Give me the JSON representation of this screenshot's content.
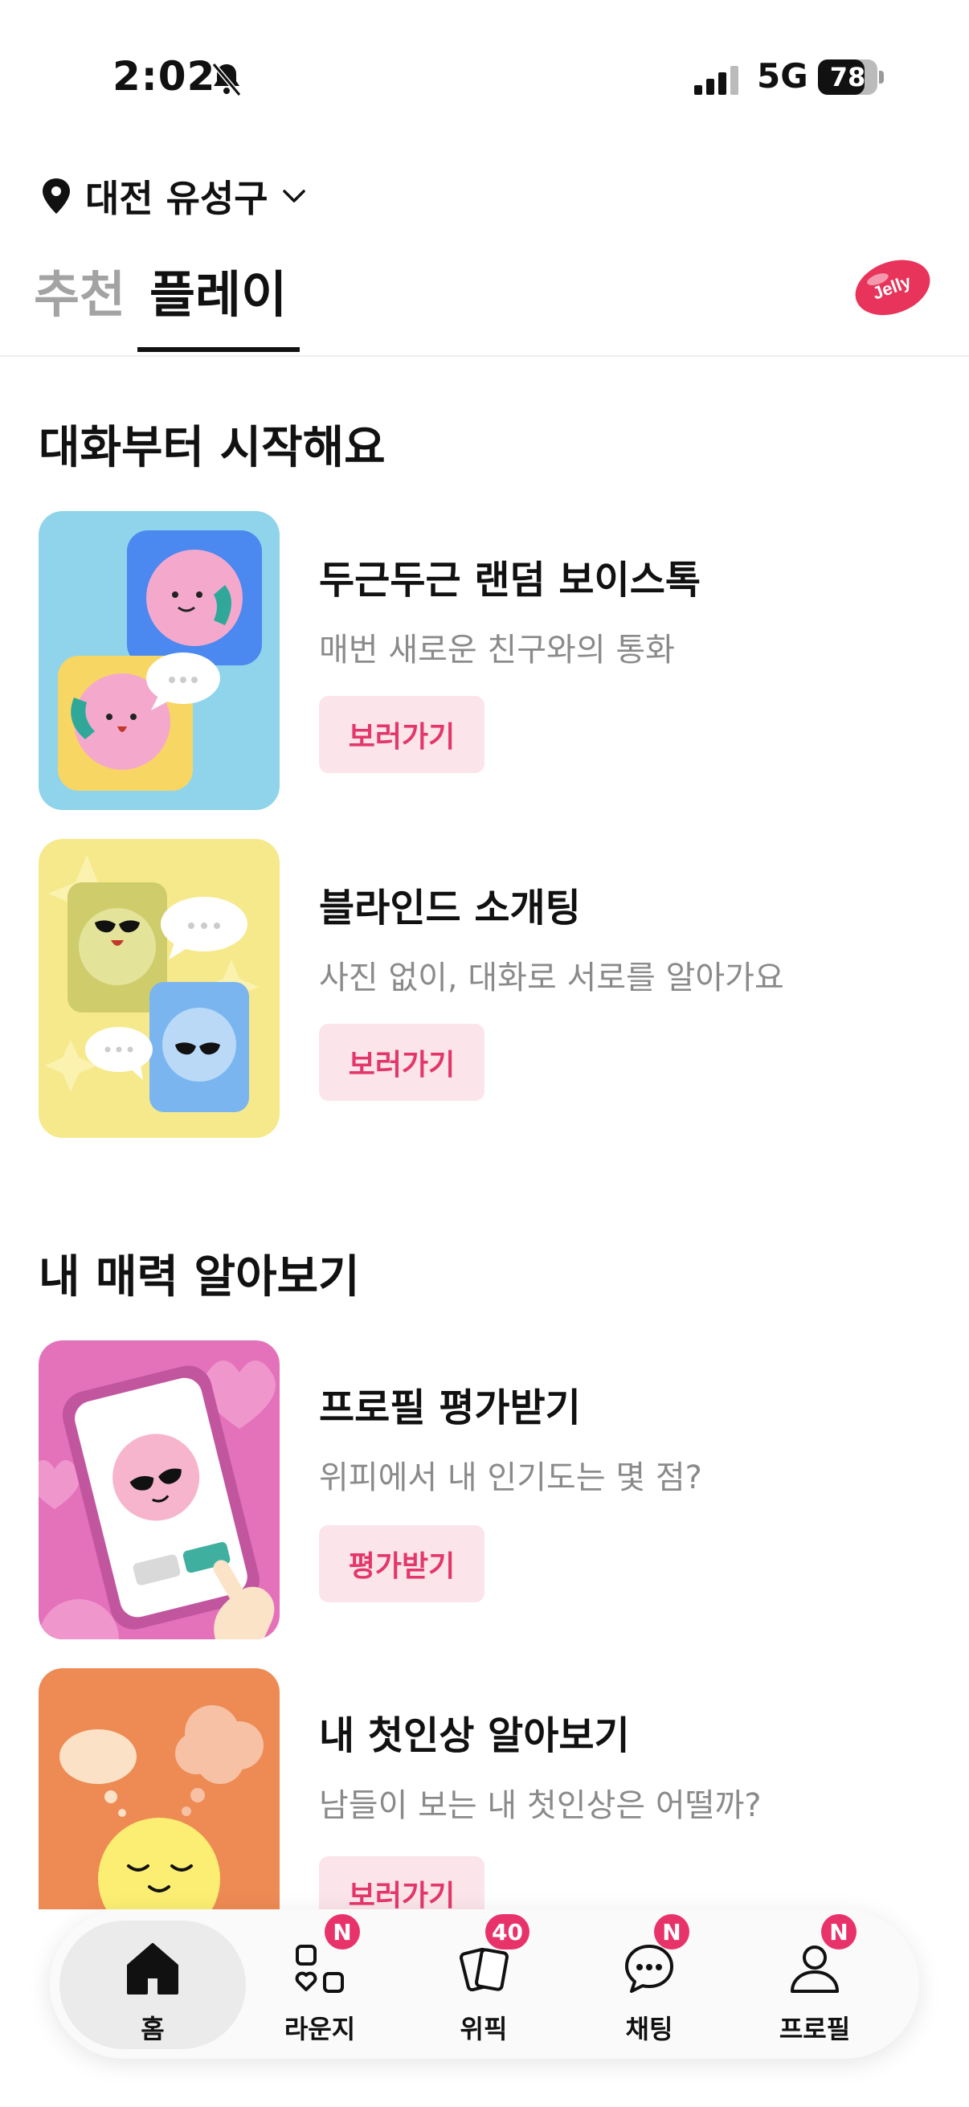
{
  "status": {
    "time": "2:02",
    "network": "5G",
    "battery": "78",
    "battery_level": 0.78
  },
  "location": {
    "label": "대전 유성구"
  },
  "tabs": [
    {
      "label": "추천",
      "active": false
    },
    {
      "label": "플레이",
      "active": true
    }
  ],
  "jelly_badge": "Jelly",
  "sections": [
    {
      "title": "대화부터 시작해요",
      "cards": [
        {
          "title": "두근두근 랜덤 보이스톡",
          "subtitle": "매번 새로운 친구와의 통화",
          "button": "보러가기"
        },
        {
          "title": "블라인드 소개팅",
          "subtitle": "사진 없이, 대화로 서로를 알아가요",
          "button": "보러가기"
        }
      ]
    },
    {
      "title": "내 매력 알아보기",
      "cards": [
        {
          "title": "프로필 평가받기",
          "subtitle": "위피에서 내 인기도는 몇 점?",
          "button": "평가받기"
        },
        {
          "title": "내 첫인상 알아보기",
          "subtitle": "남들이 보는 내 첫인상은 어떨까?",
          "button": "보러가기"
        }
      ]
    }
  ],
  "nav": [
    {
      "label": "홈",
      "icon": "home-icon",
      "badge": "",
      "active": true
    },
    {
      "label": "라운지",
      "icon": "lounge-icon",
      "badge": "N",
      "active": false
    },
    {
      "label": "위픽",
      "icon": "cards-icon",
      "badge": "40",
      "active": false
    },
    {
      "label": "채팅",
      "icon": "chat-icon",
      "badge": "N",
      "active": false
    },
    {
      "label": "프로필",
      "icon": "profile-icon",
      "badge": "N",
      "active": false
    }
  ],
  "colors": {
    "accent": "#e8336a",
    "button_bg": "#fbe4ea",
    "button_text": "#e3376b"
  }
}
